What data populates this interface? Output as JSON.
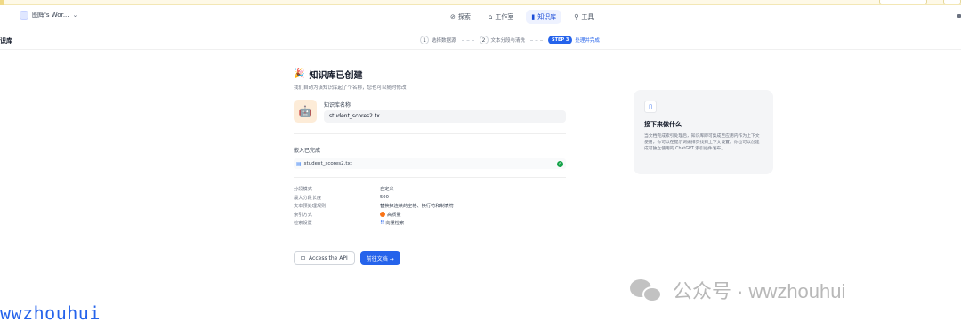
{
  "navbar": {
    "workspace": "图辉's Wor...",
    "tabs": [
      {
        "label": "探索",
        "icon": "compass-icon"
      },
      {
        "label": "工作室",
        "icon": "studio-icon"
      },
      {
        "label": "知识库",
        "icon": "book-icon"
      },
      {
        "label": "工具",
        "icon": "tool-icon"
      }
    ]
  },
  "page": {
    "title": "识库"
  },
  "steps": [
    {
      "num": "1",
      "label": "选择数据源"
    },
    {
      "num": "2",
      "label": "文本分段与清洗"
    },
    {
      "num": "STEP 3",
      "label": "处理并完成"
    }
  ],
  "main": {
    "emoji": "🎉",
    "title": "知识库已创建",
    "subtitle": "我们自动为该知识库起了个名称，您也可以随时修改",
    "name_label": "知识库名称",
    "name_value": "student_scores2.tx...",
    "embed_label": "嵌入已完成",
    "file_name": "student_scores2.txt",
    "settings": [
      {
        "key": "分段模式",
        "value": "自定义"
      },
      {
        "key": "最大分段长度",
        "value": "500"
      },
      {
        "key": "文本预处理规则",
        "value": "替换掉连续的空格、换行符和制表符"
      },
      {
        "key": "索引方式",
        "value": "高质量"
      },
      {
        "key": "检索设置",
        "value": "向量检索"
      }
    ],
    "api_button": "Access the API",
    "doc_button": "前往文档 →"
  },
  "side_card": {
    "title": "接下来做什么",
    "description": "当文档完成索引处理后，知识库即可集成至应用内作为上下文使用，你可以在提示词编排页找到上下文设置。你也可以创建成可独立使用的 ChatGPT 索引插件发布。"
  },
  "watermarks": {
    "left": "wwzhouhui",
    "right": "公众号 · wwzhouhui"
  }
}
